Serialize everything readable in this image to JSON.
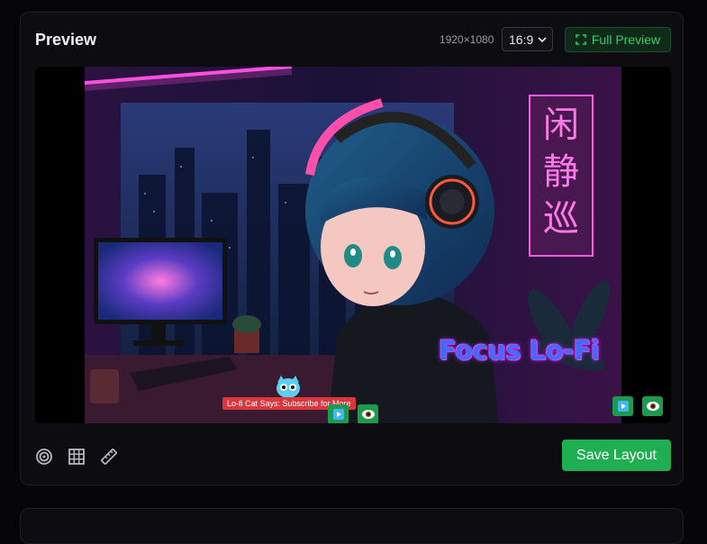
{
  "panel": {
    "title": "Preview",
    "resolution": "1920×1080",
    "aspect_ratio": {
      "selected": "16:9"
    },
    "full_preview_label": "Full Preview",
    "save_label": "Save Layout"
  },
  "preview": {
    "overlay_title": "Focus Lo-Fi",
    "ticker_text": "Lo-fi Cat Says: Subscribe for More",
    "sign_text": "闲静巡"
  },
  "colors": {
    "accent_green": "#1fae52",
    "neon_pink": "#ff3fd0",
    "neon_blue": "#3f6cff"
  },
  "toolbar_icons": [
    "target-icon",
    "grid-icon",
    "ruler-icon"
  ]
}
